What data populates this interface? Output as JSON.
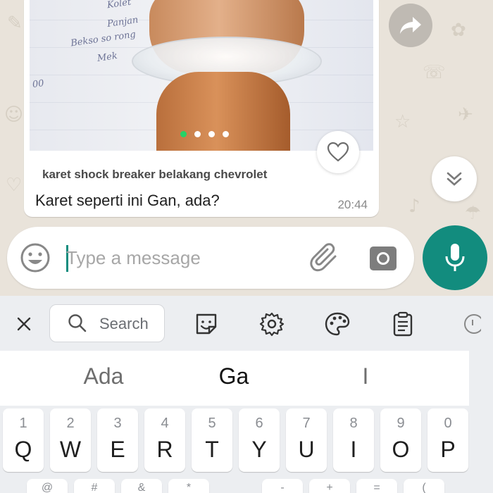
{
  "chat": {
    "message": {
      "caption_title": "karet shock breaker belakang chevrolet",
      "text": "Karet seperti ini Gan, ada?",
      "time": "20:44",
      "carousel_dots": 4,
      "carousel_active_index": 0
    }
  },
  "composer": {
    "placeholder": "Type a message"
  },
  "keyboard": {
    "search_label": "Search",
    "suggestions": [
      "Ada",
      "Ga",
      "I"
    ],
    "top_row": [
      {
        "num": "1",
        "char": "Q"
      },
      {
        "num": "2",
        "char": "W"
      },
      {
        "num": "3",
        "char": "E"
      },
      {
        "num": "4",
        "char": "R"
      },
      {
        "num": "5",
        "char": "T"
      },
      {
        "num": "6",
        "char": "Y"
      },
      {
        "num": "7",
        "char": "U"
      },
      {
        "num": "8",
        "char": "I"
      },
      {
        "num": "9",
        "char": "O"
      },
      {
        "num": "0",
        "char": "P"
      }
    ],
    "second_row_hints": [
      "@",
      "#",
      "&",
      "*",
      "-",
      "+",
      "=",
      "("
    ]
  },
  "colors": {
    "accent": "#128c7e",
    "active_dot": "#25d366",
    "wallpaper": "#e9e3da"
  },
  "icons": {
    "forward": "forward-icon",
    "scroll_down": "double-chevron-down-icon",
    "like": "heart-icon",
    "emoji": "emoji-icon",
    "attach": "paperclip-icon",
    "camera": "camera-icon",
    "mic": "mic-icon",
    "close": "close-icon",
    "search": "search-icon",
    "sticker": "sticker-icon",
    "settings": "gear-icon",
    "theme": "palette-icon",
    "clipboard": "clipboard-icon"
  }
}
